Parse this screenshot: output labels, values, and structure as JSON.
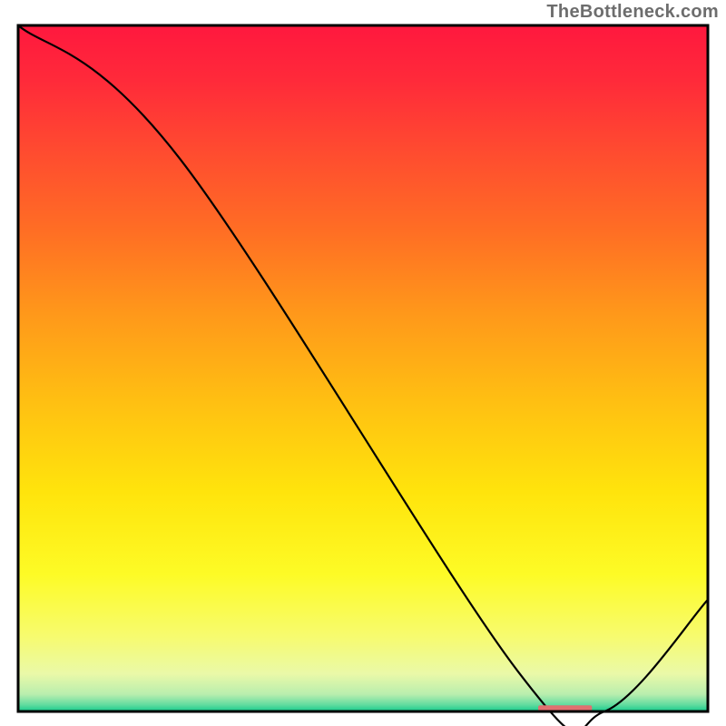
{
  "attribution": "TheBottleneck.com",
  "chart_data": {
    "type": "line",
    "title": "",
    "xlabel": "",
    "ylabel": "",
    "xlim": [
      0,
      100
    ],
    "ylim": [
      0,
      100
    ],
    "x": [
      0,
      23.5,
      72.5,
      85,
      100
    ],
    "y": [
      100,
      80.5,
      5.8,
      0,
      16.3
    ],
    "marker": {
      "x_center": 79.3,
      "width": 7.8,
      "y": 0.5
    },
    "background_gradient": {
      "stops": [
        {
          "offset": 0.0,
          "color": "#ff183e"
        },
        {
          "offset": 0.08,
          "color": "#ff2a3a"
        },
        {
          "offset": 0.18,
          "color": "#ff4a30"
        },
        {
          "offset": 0.3,
          "color": "#ff6e24"
        },
        {
          "offset": 0.42,
          "color": "#ff981a"
        },
        {
          "offset": 0.55,
          "color": "#ffc012"
        },
        {
          "offset": 0.68,
          "color": "#ffe40c"
        },
        {
          "offset": 0.8,
          "color": "#fdfb26"
        },
        {
          "offset": 0.89,
          "color": "#f7fb6e"
        },
        {
          "offset": 0.945,
          "color": "#eaf9a8"
        },
        {
          "offset": 0.975,
          "color": "#b9eeae"
        },
        {
          "offset": 0.99,
          "color": "#63dca0"
        },
        {
          "offset": 1.0,
          "color": "#14c98b"
        }
      ]
    },
    "curve_color": "#000000",
    "frame_color": "#000000",
    "marker_color": "#e07070"
  }
}
